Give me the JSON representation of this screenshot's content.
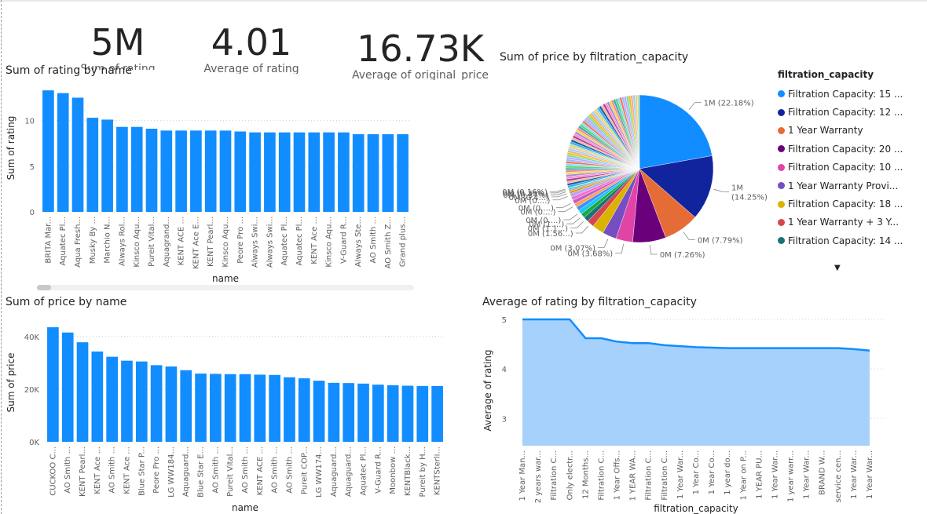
{
  "kpis": [
    {
      "value": "5M",
      "label": "Sum of rating"
    },
    {
      "value": "4.01",
      "label": "Average of rating"
    },
    {
      "value": "16.73K",
      "label": "Average of original_price"
    }
  ],
  "colors": {
    "bar": "#118dff",
    "area_fill": "#a5d1fc",
    "area_line": "#118dff"
  },
  "chart_data": [
    {
      "id": "rating_by_name",
      "type": "bar",
      "title": "Sum of rating by name",
      "xlabel": "name",
      "ylabel": "Sum of rating",
      "ylim": [
        0,
        14
      ],
      "yticks": [
        "0",
        "5",
        "10"
      ],
      "ytick_values": [
        0,
        5,
        10
      ],
      "categories": [
        "BRITA Mar...",
        "Aquatec Pl...",
        "Aqua Fresh...",
        "Musky By ...",
        "Marchio N...",
        "Always Rol...",
        "Kinsco Aqu...",
        "Pureit Vital...",
        "Aquagrand...",
        "KENT ACE ...",
        "KENT Ace E...",
        "KENT Pearl...",
        "Kinsco Aqu...",
        "Peore Pro ...",
        "Always Swi...",
        "Always Swi...",
        "Aquatec Pl...",
        "Aquatec Pl...",
        "KENT Ace ...",
        "Kinsco Aqu...",
        "V-Guard R...",
        "Always Ste...",
        "AO Smith ...",
        "AO Smith Z...",
        "Grand plus..."
      ],
      "values": [
        13.3,
        13.0,
        12.5,
        10.3,
        10.1,
        9.3,
        9.3,
        9.1,
        8.9,
        8.9,
        8.9,
        8.9,
        8.9,
        8.8,
        8.7,
        8.7,
        8.7,
        8.7,
        8.7,
        8.7,
        8.7,
        8.5,
        8.5,
        8.5,
        8.5
      ]
    },
    {
      "id": "price_by_filtration_capacity",
      "type": "pie",
      "title": "Sum of price by filtration_capacity",
      "legend_title": "filtration_capacity",
      "legend_placement": "right",
      "legend": [
        {
          "label": "Filtration Capacity: 15 ...",
          "color": "#118dff"
        },
        {
          "label": "Filtration Capacity: 12 ...",
          "color": "#12239e"
        },
        {
          "label": "1 Year Warranty",
          "color": "#e66c37"
        },
        {
          "label": "Filtration Capacity: 20 ...",
          "color": "#6b007b"
        },
        {
          "label": "Filtration Capacity: 10 ...",
          "color": "#e044a7"
        },
        {
          "label": "1 Year Warranty Provi...",
          "color": "#744ec2"
        },
        {
          "label": "Filtration Capacity: 18 ...",
          "color": "#d9b300"
        },
        {
          "label": "1 Year Warranty + 3 Y...",
          "color": "#d64550"
        },
        {
          "label": "Filtration Capacity: 14 ...",
          "color": "#197278"
        }
      ],
      "slices": [
        {
          "label": "1M (22.18%)",
          "percent": 22.18,
          "color": "#118dff"
        },
        {
          "label": "1M (14.25%)",
          "percent": 14.25,
          "color": "#12239e"
        },
        {
          "label": "0M (7.79%)",
          "percent": 7.79,
          "color": "#e66c37"
        },
        {
          "label": "0M (7.26%)",
          "percent": 7.26,
          "color": "#6b007b"
        },
        {
          "label": "0M (3.68%)",
          "percent": 3.68,
          "color": "#e044a7"
        },
        {
          "label": "0M (3.07%)",
          "percent": 3.07,
          "color": "#744ec2"
        },
        {
          "label": "",
          "percent": 2.6,
          "color": "#d9b300"
        },
        {
          "label": "0M (1.56...)",
          "percent": 1.56,
          "color": "#d64550"
        },
        {
          "label": "0M (1.1...)",
          "percent": 1.1,
          "color": "#197278"
        },
        {
          "label": "0M (1....)",
          "percent": 1.0,
          "color": "#1aab40"
        },
        {
          "label": "0M (0....)",
          "percent": 0.9,
          "color": "#15c6f4"
        },
        {
          "label": "",
          "percent": 0.9,
          "color": "#4092ff"
        },
        {
          "label": "0M (0....)",
          "percent": 0.85,
          "color": "#ffa058"
        },
        {
          "label": "0M (0....)",
          "percent": 0.8,
          "color": "#be5dc9"
        },
        {
          "label": "",
          "percent": 0.8,
          "color": "#f472d0"
        },
        {
          "label": "0M (0....)",
          "percent": 0.75,
          "color": "#b5a1ff"
        },
        {
          "label": "0M (0.4...)",
          "percent": 0.45,
          "color": "#c4a200"
        },
        {
          "label": "0M (0.37%)",
          "percent": 0.37,
          "color": "#ff8080"
        },
        {
          "label": "0M (0.33%)",
          "percent": 0.33,
          "color": "#00dbbc"
        },
        {
          "label": "0M (0.16%)",
          "percent": 0.16,
          "color": "#5bd667"
        }
      ]
    },
    {
      "id": "price_by_name",
      "type": "bar",
      "title": "Sum of price by name",
      "xlabel": "name",
      "ylabel": "Sum of price",
      "ylim": [
        0,
        45000
      ],
      "yticks": [
        "0K",
        "20K",
        "40K"
      ],
      "ytick_values": [
        0,
        20000,
        40000
      ],
      "categories": [
        "CUCKOO C...",
        "AO Smith ...",
        "KENT Pearl...",
        "KENT Ace ...",
        "AO Smith ...",
        "KENT Ace ...",
        "Blue Star P...",
        "Peore Pro ...",
        "LG WW184...",
        "Aquaguard...",
        "Blue Star E...",
        "AO Smith ...",
        "Pureit Vital...",
        "AO Smith ...",
        "KENT ACE ...",
        "AO Smith ...",
        "AO Smith ...",
        "Pureit COP...",
        "LG WW174...",
        "Aquaguard...",
        "Aquaguard...",
        "Aquatec Pl...",
        "V-Guard R...",
        "Moonbow ...",
        "KENTBlack...",
        "Pureit by H...",
        "KENTSterli..."
      ],
      "values": [
        43500,
        41500,
        37800,
        34300,
        32300,
        30800,
        30500,
        29100,
        28600,
        27200,
        25900,
        25800,
        25700,
        25700,
        25500,
        25400,
        24500,
        24100,
        23200,
        22400,
        22300,
        22100,
        21700,
        21500,
        21300,
        21200,
        21200
      ]
    },
    {
      "id": "avg_rating_by_filtration_capacity",
      "type": "area",
      "title": "Average of rating by filtration_capacity",
      "xlabel": "filtration_capacity",
      "ylabel": "Average of rating",
      "ylim": [
        2.45,
        5.0
      ],
      "yticks": [
        "3",
        "4",
        "5"
      ],
      "ytick_values": [
        3,
        4,
        5
      ],
      "categories": [
        "1 Year Man...",
        "2 years war...",
        "Filtration C...",
        "Only electr...",
        "12 Months...",
        "Filtration C...",
        "1 Year Offs...",
        "1 YEAR WA...",
        "Filtration C...",
        "Filtration C...",
        "1 Year War...",
        "1 Year Co...",
        "1 Year Co...",
        "1 year do...",
        "1 Year on P...",
        "1 YEAR PU...",
        "1 Year War...",
        "1 year warr...",
        "1 Year War...",
        "BRAND W...",
        "service cen...",
        "1 Year War...",
        "1 Year War..."
      ],
      "values": [
        5.0,
        5.0,
        5.0,
        5.0,
        4.62,
        4.62,
        4.55,
        4.52,
        4.52,
        4.48,
        4.46,
        4.44,
        4.43,
        4.42,
        4.42,
        4.42,
        4.42,
        4.42,
        4.42,
        4.42,
        4.42,
        4.4,
        4.37
      ]
    }
  ]
}
